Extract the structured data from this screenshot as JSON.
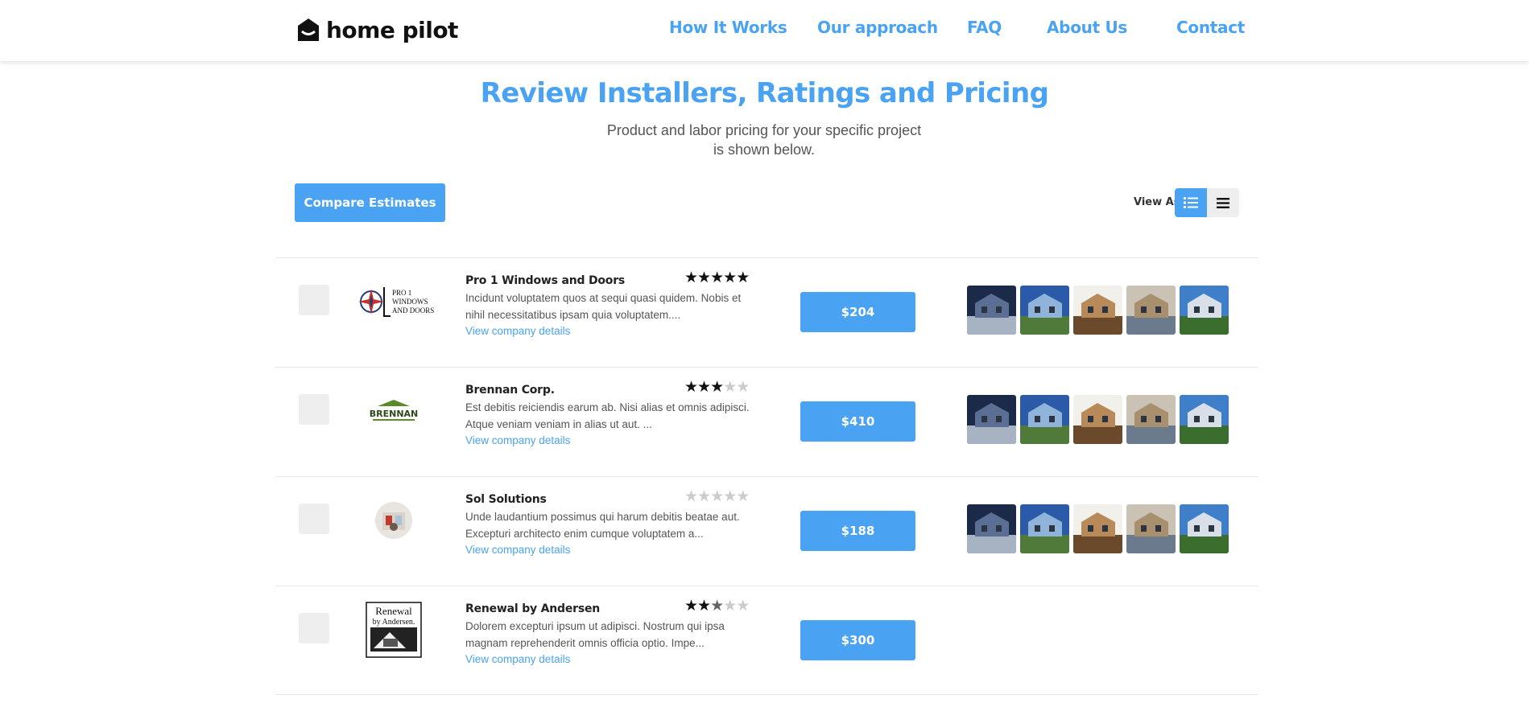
{
  "header": {
    "logo_text": "home pilot",
    "nav": [
      {
        "label": "How It Works"
      },
      {
        "label": "Our approach"
      },
      {
        "label": "FAQ"
      },
      {
        "label": "About Us"
      },
      {
        "label": "Contact"
      }
    ]
  },
  "hero": {
    "title": "Review Installers, Ratings and Pricing",
    "subtitle": "Product and labor pricing for your specific project is shown below."
  },
  "toolbar": {
    "compare_label": "Compare Estimates",
    "view_as_label": "View As"
  },
  "colors": {
    "accent": "#4aa3f2",
    "checkbox": "#eeeeee"
  },
  "installers": [
    {
      "name": "Pro 1 Windows and Doors",
      "rating": 5,
      "description": "Incidunt voluptatem quos at sequi quasi quidem. Nobis et nihil necessitatibus ipsam quia voluptatem....",
      "details_label": "View company details",
      "price": "$204",
      "logo_text": [
        "PRO 1",
        "WINDOWS",
        "AND DOORS"
      ],
      "has_gallery": true
    },
    {
      "name": "Brennan Corp.",
      "rating": 3,
      "description": "Est debitis reiciendis earum ab. Nisi alias et omnis adipisci. Atque veniam veniam in alias ut aut. ...",
      "details_label": "View company details",
      "price": "$410",
      "logo_text": [
        "BRENNAN"
      ],
      "has_gallery": true
    },
    {
      "name": "Sol Solutions",
      "rating": 0,
      "description": "Unde laudantium possimus qui harum debitis beatae aut. Excepturi architecto enim cumque voluptatem a...",
      "details_label": "View company details",
      "price": "$188",
      "logo_text": [],
      "has_gallery": true
    },
    {
      "name": "Renewal by Andersen",
      "rating": 2.5,
      "description": "Dolorem excepturi ipsum ut adipisci. Nostrum qui ipsa magnam reprehenderit omnis officia optio. Impe...",
      "details_label": "View company details",
      "price": "$300",
      "logo_text": [
        "Renewal",
        "by Andersen."
      ],
      "has_gallery": false
    }
  ]
}
